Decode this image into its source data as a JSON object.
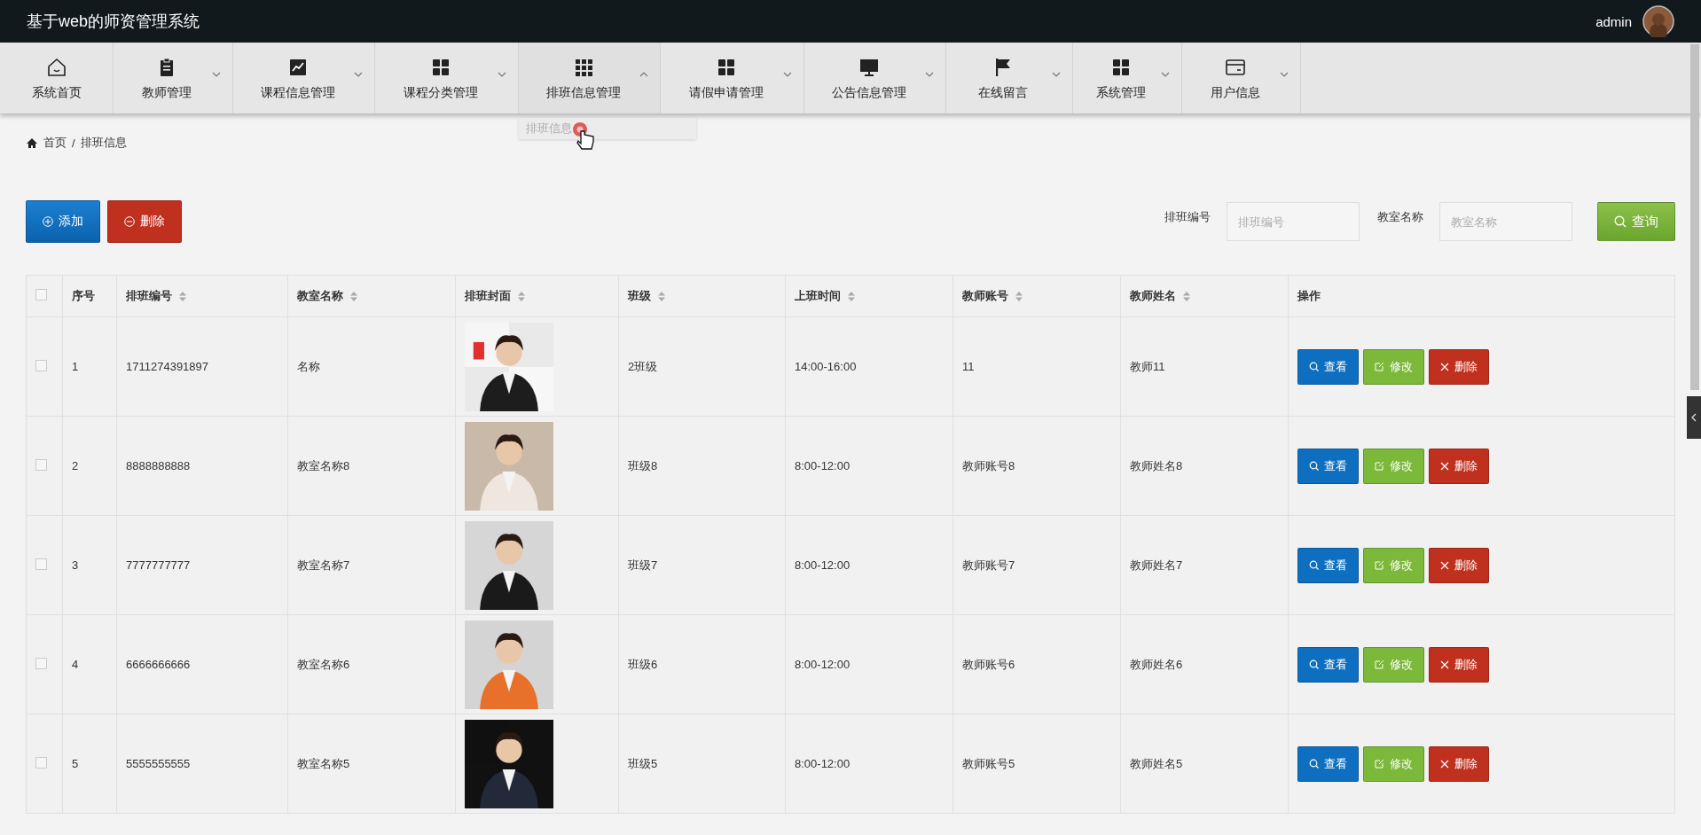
{
  "header": {
    "title": "基于web的师资管理系统",
    "user": "admin"
  },
  "nav": [
    {
      "label": "系统首页",
      "dropdown": false
    },
    {
      "label": "教师管理",
      "dropdown": true,
      "expanded": false
    },
    {
      "label": "课程信息管理",
      "dropdown": true,
      "expanded": false
    },
    {
      "label": "课程分类管理",
      "dropdown": true,
      "expanded": false
    },
    {
      "label": "排班信息管理",
      "dropdown": true,
      "expanded": true,
      "menu": [
        "排班信息"
      ]
    },
    {
      "label": "请假申请管理",
      "dropdown": true,
      "expanded": false
    },
    {
      "label": "公告信息管理",
      "dropdown": true,
      "expanded": false
    },
    {
      "label": "在线留言",
      "dropdown": true,
      "expanded": false
    },
    {
      "label": "系统管理",
      "dropdown": true,
      "expanded": false
    },
    {
      "label": "用户信息",
      "dropdown": true,
      "expanded": false
    }
  ],
  "breadcrumb": {
    "home": "首页",
    "separator": "/",
    "current": "排班信息"
  },
  "actions": [
    {
      "label": "添加",
      "kind": "add"
    },
    {
      "label": "删除",
      "kind": "delete"
    }
  ],
  "search": {
    "fields": [
      {
        "label": "排班编号",
        "placeholder": "排班编号"
      },
      {
        "label": "教室名称",
        "placeholder": "教室名称"
      }
    ],
    "button": "查询"
  },
  "table": {
    "columns": [
      {
        "label": "序号",
        "sortable": false
      },
      {
        "label": "排班编号",
        "sortable": true
      },
      {
        "label": "教室名称",
        "sortable": true
      },
      {
        "label": "排班封面",
        "sortable": true
      },
      {
        "label": "班级",
        "sortable": true
      },
      {
        "label": "上班时间",
        "sortable": true
      },
      {
        "label": "教师账号",
        "sortable": true
      },
      {
        "label": "教师姓名",
        "sortable": true
      },
      {
        "label": "操作",
        "sortable": false
      }
    ],
    "all_checked": false,
    "rows": [
      {
        "checked": false,
        "index": "1",
        "code": "1711274391897",
        "room": "名称",
        "class": "2班级",
        "time": "14:00-16:00",
        "account": "11",
        "teacher": "教师11",
        "actions": [
          {
            "label": "查看",
            "kind": "view"
          },
          {
            "label": "修改",
            "kind": "edit"
          },
          {
            "label": "删除",
            "kind": "delete"
          }
        ]
      },
      {
        "checked": false,
        "index": "2",
        "code": "8888888888",
        "room": "教室名称8",
        "class": "班级8",
        "time": "8:00-12:00",
        "account": "教师账号8",
        "teacher": "教师姓名8",
        "actions": [
          {
            "label": "查看",
            "kind": "view"
          },
          {
            "label": "修改",
            "kind": "edit"
          },
          {
            "label": "删除",
            "kind": "delete"
          }
        ]
      },
      {
        "checked": false,
        "index": "3",
        "code": "7777777777",
        "room": "教室名称7",
        "class": "班级7",
        "time": "8:00-12:00",
        "account": "教师账号7",
        "teacher": "教师姓名7",
        "actions": [
          {
            "label": "查看",
            "kind": "view"
          },
          {
            "label": "修改",
            "kind": "edit"
          },
          {
            "label": "删除",
            "kind": "delete"
          }
        ]
      },
      {
        "checked": false,
        "index": "4",
        "code": "6666666666",
        "room": "教室名称6",
        "class": "班级6",
        "time": "8:00-12:00",
        "account": "教师账号6",
        "teacher": "教师姓名6",
        "actions": [
          {
            "label": "查看",
            "kind": "view"
          },
          {
            "label": "修改",
            "kind": "edit"
          },
          {
            "label": "删除",
            "kind": "delete"
          }
        ]
      },
      {
        "checked": false,
        "index": "5",
        "code": "5555555555",
        "room": "教室名称5",
        "class": "班级5",
        "time": "8:00-12:00",
        "account": "教师账号5",
        "teacher": "教师姓名5",
        "actions": [
          {
            "label": "查看",
            "kind": "view"
          },
          {
            "label": "修改",
            "kind": "edit"
          },
          {
            "label": "删除",
            "kind": "delete"
          }
        ]
      }
    ]
  }
}
